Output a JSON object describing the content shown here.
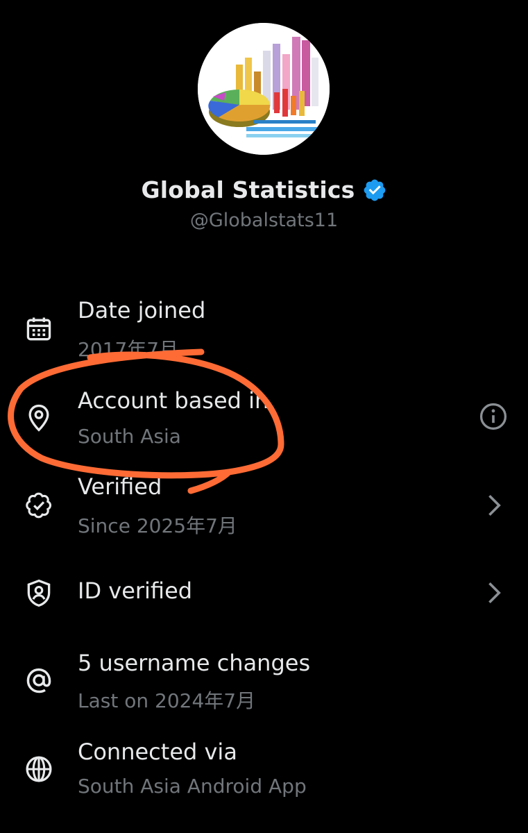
{
  "profile": {
    "display_name": "Global Statistics",
    "handle": "@Globalstats11",
    "verified_badge_color": "#1d9bf0"
  },
  "rows": [
    {
      "title": "Date joined",
      "subtitle": "2017年7月",
      "icon": "calendar-icon"
    },
    {
      "title": "Account based in",
      "subtitle": "South Asia",
      "icon": "location-pin-icon",
      "action": "info-icon"
    },
    {
      "title": "Verified",
      "subtitle": "Since 2025年7月",
      "icon": "verified-check-icon",
      "action": "chevron-right-icon"
    },
    {
      "title": "ID verified",
      "icon": "id-shield-icon",
      "action": "chevron-right-icon"
    },
    {
      "title": "5 username changes",
      "subtitle": "Last on 2024年7月",
      "icon": "at-sign-icon"
    },
    {
      "title": "Connected via",
      "subtitle": "South Asia Android App",
      "icon": "globe-icon"
    }
  ],
  "colors": {
    "background": "#000000",
    "primary_text": "#e7e9ea",
    "secondary_text": "#71767b",
    "annotation": "#ff6b35"
  }
}
